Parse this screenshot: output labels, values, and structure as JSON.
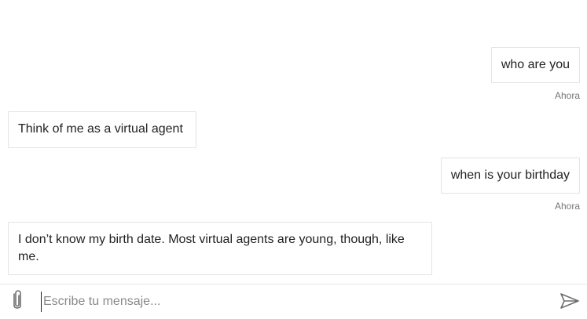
{
  "messages": [
    {
      "from": "user",
      "text": "who are you",
      "time": "Ahora"
    },
    {
      "from": "bot",
      "text": "Think of me as a virtual agent"
    },
    {
      "from": "user",
      "text": "when is your birthday",
      "time": "Ahora"
    },
    {
      "from": "bot",
      "text": "I don’t know my birth date. Most virtual agents are young, though, like me."
    }
  ],
  "composer": {
    "placeholder": "Escribe tu mensaje...",
    "value": "",
    "attach_icon": "paperclip-icon",
    "send_icon": "send-icon"
  }
}
